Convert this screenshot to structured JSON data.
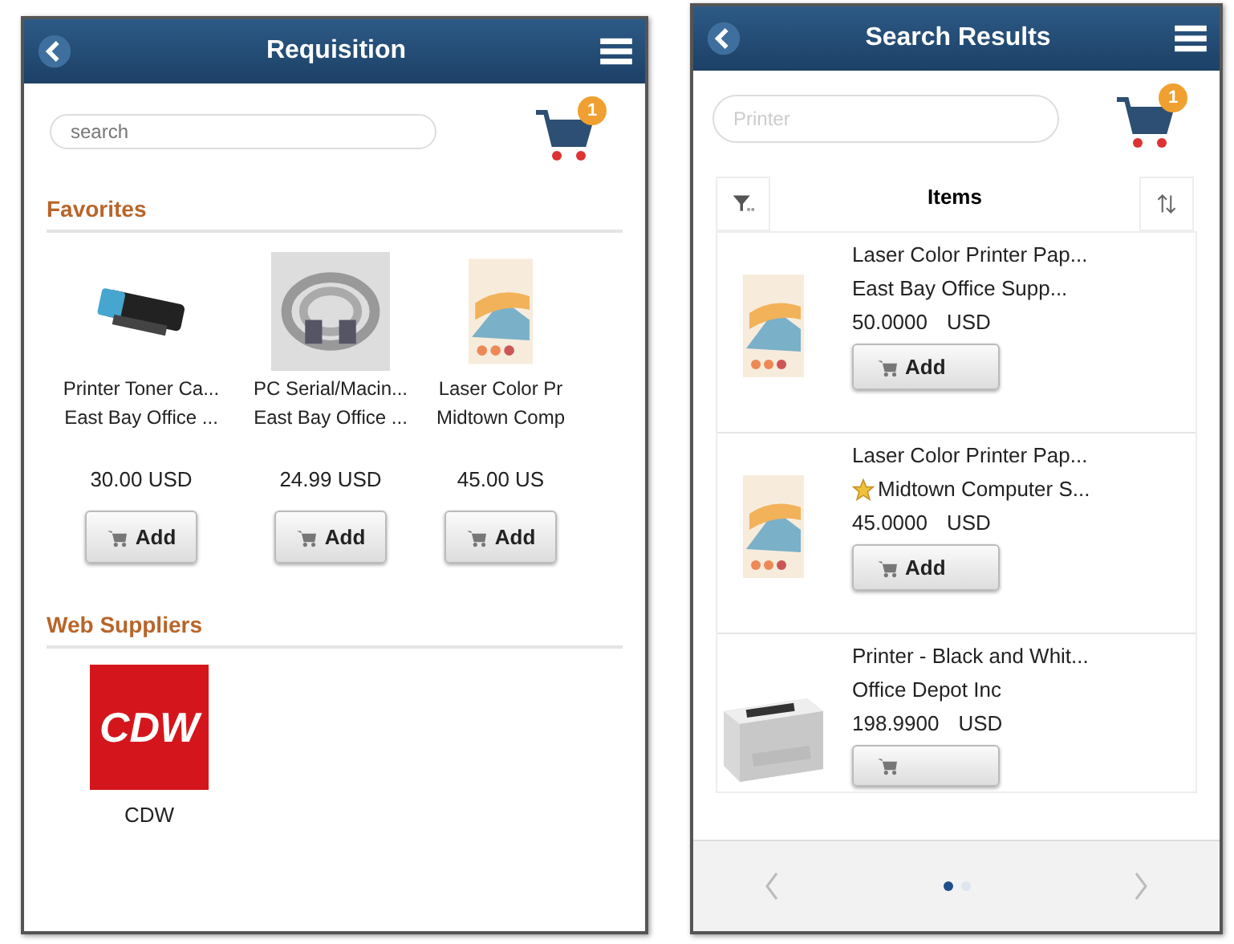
{
  "requisition": {
    "title": "Requisition",
    "search": {
      "placeholder": "search"
    },
    "cart_count": "1",
    "favorites": {
      "heading": "Favorites",
      "items": [
        {
          "kind": "toner",
          "name": "Printer Toner Ca...",
          "supplier": "East Bay Office ...",
          "price": "30.00 USD",
          "button": "Add"
        },
        {
          "kind": "cable",
          "name": "PC Serial/Macin...",
          "supplier": "East Bay Office ...",
          "price": "24.99 USD",
          "button": "Add"
        },
        {
          "kind": "paper",
          "name": "Laser Color Pr",
          "supplier": "Midtown Comp",
          "price": "45.00 US",
          "button": "Add"
        }
      ]
    },
    "web_suppliers": {
      "heading": "Web Suppliers",
      "items": [
        {
          "logo": "CDW",
          "name": "CDW"
        }
      ]
    }
  },
  "search_results": {
    "title": "Search Results",
    "search": {
      "placeholder": "Printer"
    },
    "cart_count": "1",
    "list_title": "Items",
    "items": [
      {
        "kind": "paper",
        "name": "Laser Color Printer Pap...",
        "supplier": "East Bay Office Supp...",
        "favorite": false,
        "price": "50.0000",
        "currency": "USD",
        "button": "Add"
      },
      {
        "kind": "paper",
        "name": "Laser Color Printer Pap...",
        "supplier": "Midtown Computer S...",
        "favorite": true,
        "price": "45.0000",
        "currency": "USD",
        "button": "Add"
      },
      {
        "kind": "printer",
        "name": "Printer - Black and Whit...",
        "supplier": "Office Depot Inc",
        "favorite": false,
        "price": "198.9900",
        "currency": "USD"
      }
    ],
    "pages": [
      {
        "selected": true
      },
      {
        "selected": false
      }
    ]
  }
}
